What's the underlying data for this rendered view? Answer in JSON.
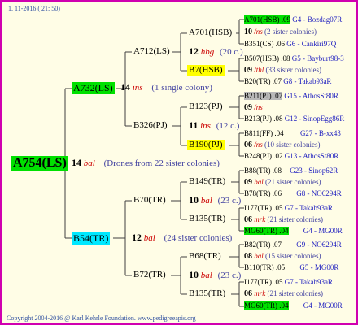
{
  "header": {
    "date": "1. 11-2016 ( 21: 50)"
  },
  "footer": {
    "copyright": "Copyright 2004-2016 @ Karl Kehrle Foundation.   www.pedigreeapis.org"
  },
  "root": {
    "name": "A754(LS)"
  },
  "gen1": {
    "top": {
      "name": "A732(LS)",
      "year": "14",
      "mark": "ins",
      "note": "(1 single colony)"
    },
    "mid": {
      "year": "14",
      "mark": "bal",
      "note": "(Drones from 22 sister colonies)"
    },
    "bot": {
      "name": "B54(TR)",
      "year": "12",
      "mark": "bal",
      "note": "(24 sister colonies)"
    }
  },
  "gen2": [
    {
      "name": "A712(LS)",
      "year": "12",
      "mark": "hbg",
      "note": "(20 c.)"
    },
    {
      "name": "B326(PJ)",
      "year": "11",
      "mark": "ins",
      "note": "(12 c.)"
    },
    {
      "name": "B70(TR)",
      "year": "10",
      "mark": "bal",
      "note": "(23 c.)"
    },
    {
      "name": "B72(TR)",
      "year": "10",
      "mark": "bal",
      "note": "(23 c.)"
    }
  ],
  "gen3": [
    {
      "name": "A701(HSB)"
    },
    {
      "name": "B7(HSB)"
    },
    {
      "name": "B123(PJ)"
    },
    {
      "name": "B190(PJ)"
    },
    {
      "name": "B149(TR)"
    },
    {
      "name": "B135(TR)"
    },
    {
      "name": "B68(TR)"
    },
    {
      "name": "B135(TR)"
    }
  ],
  "right": [
    {
      "left": "A701(HSB) .09",
      "info": "G4 - Bozdag07R"
    },
    {
      "year": "10",
      "mark": "/ns",
      "note": "(2 sister colonies)"
    },
    {
      "left": "B351(CS) .06",
      "info": "G6 - Cankiri97Q"
    },
    {
      "left": "B507(HSB) .08",
      "info": "G5 - Bayburt98-3"
    },
    {
      "year": "09",
      "mark": "/thl",
      "note": "(33 sister colonies)"
    },
    {
      "left": "B20(TR) .07",
      "info": "G8 - Takab93aR"
    },
    {
      "left": "B211(PJ) .07",
      "info": "G15 - AthosSt80R"
    },
    {
      "year": "09",
      "mark": "/ns",
      "note": ""
    },
    {
      "left": "B213(PJ) .08",
      "info": "G12 - SinopEgg86R"
    },
    {
      "left": "B811(FF) .04",
      "info": "G27 - B-xx43"
    },
    {
      "year": "06",
      "mark": "/ns",
      "note": "(10 sister colonies)"
    },
    {
      "left": "B248(PJ) .02",
      "info": "G13 - AthosSt80R"
    },
    {
      "left": "B88(TR) .08",
      "info": "G23 - Sinop62R"
    },
    {
      "year": "09",
      "mark": "bal",
      "note": "(21 sister colonies)"
    },
    {
      "left": "B78(TR) .06",
      "info": "G8 - NO6294R"
    },
    {
      "left": "I177(TR) .05",
      "info": "G7 - Takab93aR"
    },
    {
      "year": "06",
      "mark": "mrk",
      "note": "(21 sister colonies)"
    },
    {
      "left": "MG60(TR) .04",
      "info": "G4 - MG00R"
    },
    {
      "left": "B82(TR) .07",
      "info": "G9 - NO6294R"
    },
    {
      "year": "08",
      "mark": "bal",
      "note": "(15 sister colonies)"
    },
    {
      "left": "B110(TR) .05",
      "info": "G5 - MG00R"
    },
    {
      "left": "I177(TR) .05",
      "info": "G7 - Takab93aR"
    },
    {
      "year": "06",
      "mark": "mrk",
      "note": "(21 sister colonies)"
    },
    {
      "left": "MG60(TR) .04",
      "info": "G4 - MG00R"
    }
  ]
}
